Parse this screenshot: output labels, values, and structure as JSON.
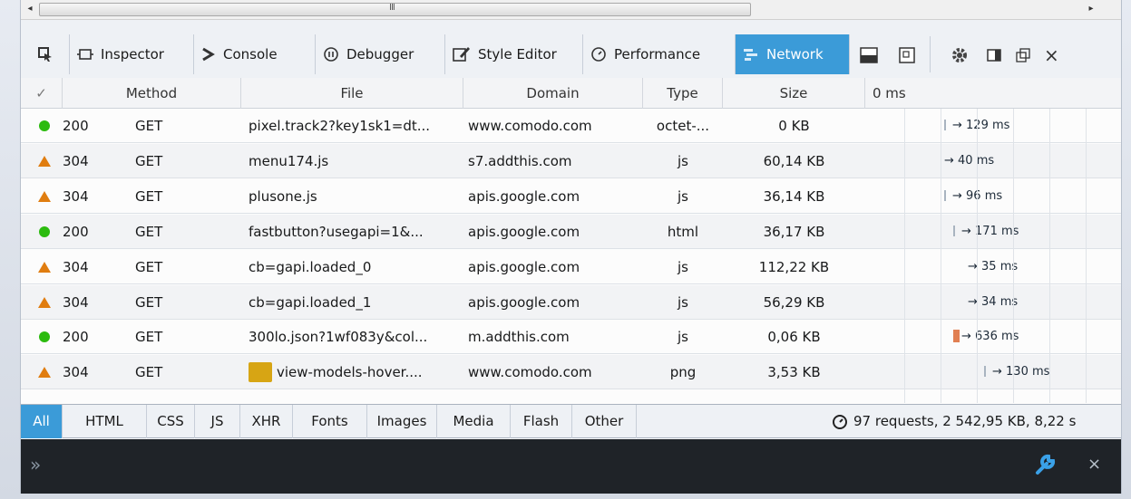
{
  "scrollbar": {
    "grip": "III",
    "left_arrow": "◂",
    "right_arrow": "▸"
  },
  "toolbar": {
    "inspector": "Inspector",
    "console": "Console",
    "debugger": "Debugger",
    "style_editor": "Style Editor",
    "performance": "Performance",
    "network": "Network",
    "close": "×"
  },
  "columns": {
    "status": "✓",
    "method": "Method",
    "file": "File",
    "domain": "Domain",
    "type": "Type",
    "size": "Size",
    "timeline": "0 ms"
  },
  "rows": [
    {
      "status_kind": "ok",
      "status": "200",
      "method": "GET",
      "file": "pixel.track2?key1sk1=dt...",
      "domain": "www.comodo.com",
      "type": "octet-...",
      "size": "0 KB",
      "timing": "→ 129 ms",
      "wf_start": 0.0,
      "bar": "tick"
    },
    {
      "status_kind": "warn",
      "status": "304",
      "method": "GET",
      "file": "menu174.js",
      "domain": "s7.addthis.com",
      "type": "js",
      "size": "60,14 KB",
      "timing": "→ 40 ms",
      "wf_start": 0.0,
      "bar": "none"
    },
    {
      "status_kind": "warn",
      "status": "304",
      "method": "GET",
      "file": "plusone.js",
      "domain": "apis.google.com",
      "type": "js",
      "size": "36,14 KB",
      "timing": "→ 96 ms",
      "wf_start": 0.0,
      "bar": "tick"
    },
    {
      "status_kind": "ok",
      "status": "200",
      "method": "GET",
      "file": "fastbutton?usegapi=1&...",
      "domain": "apis.google.com",
      "type": "html",
      "size": "36,17 KB",
      "timing": "→ 171 ms",
      "wf_start": 0.05,
      "bar": "tick"
    },
    {
      "status_kind": "warn",
      "status": "304",
      "method": "GET",
      "file": "cb=gapi.loaded_0",
      "domain": "apis.google.com",
      "type": "js",
      "size": "112,22 KB",
      "timing": "→ 35 ms",
      "wf_start": 0.13,
      "bar": "none"
    },
    {
      "status_kind": "warn",
      "status": "304",
      "method": "GET",
      "file": "cb=gapi.loaded_1",
      "domain": "apis.google.com",
      "type": "js",
      "size": "56,29 KB",
      "timing": "→ 34 ms",
      "wf_start": 0.13,
      "bar": "none"
    },
    {
      "status_kind": "ok",
      "status": "200",
      "method": "GET",
      "file": "300lo.json?1wf083y&col...",
      "domain": "m.addthis.com",
      "type": "js",
      "size": "0,06 KB",
      "timing": "→ 636 ms",
      "wf_start": 0.05,
      "bar": "block"
    },
    {
      "status_kind": "warn",
      "status": "304",
      "method": "GET",
      "file": "view-models-hover....",
      "domain": "www.comodo.com",
      "type": "png",
      "size": "3,53 KB",
      "timing": "→ 130 ms",
      "wf_start": 0.22,
      "bar": "tick",
      "thumb": true
    }
  ],
  "filters": [
    "All",
    "HTML",
    "CSS",
    "JS",
    "XHR",
    "Fonts",
    "Images",
    "Media",
    "Flash",
    "Other"
  ],
  "active_filter": "All",
  "summary": "97 requests, 2 542,95 KB, 8,22 s",
  "console": {
    "prompt": "»",
    "close": "×"
  },
  "colors": {
    "accent": "#3b9bd8",
    "ok": "#2cbb0f",
    "warn": "#e07d10",
    "console_bg": "#1f2328"
  }
}
